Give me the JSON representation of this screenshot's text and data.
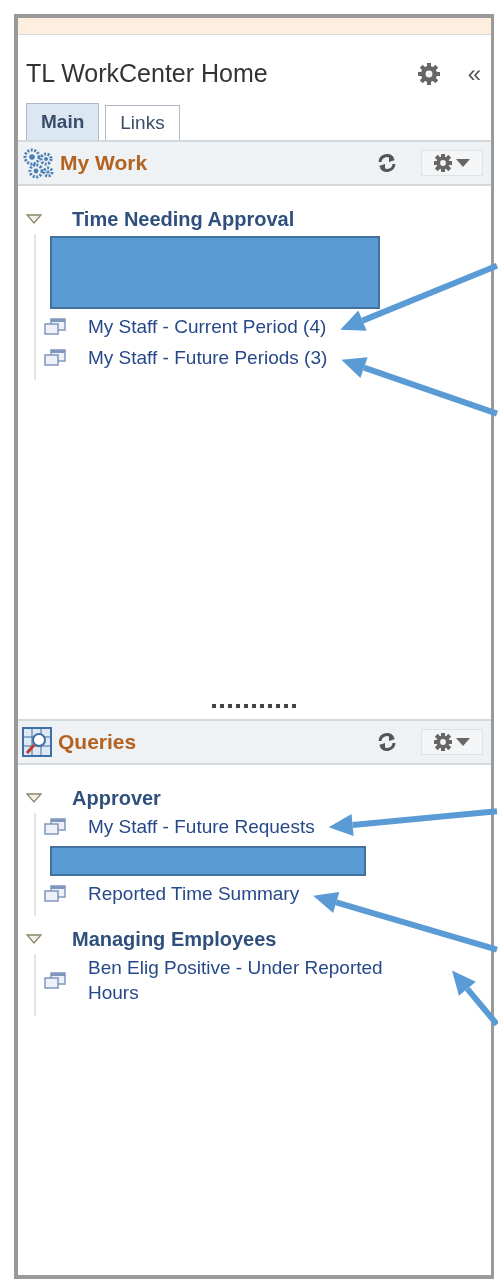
{
  "title": "TL WorkCenter Home",
  "collapse": "«",
  "tabs": [
    {
      "label": "Main",
      "selected": true
    },
    {
      "label": "Links",
      "selected": false
    }
  ],
  "pagelets": [
    {
      "title": "My Work",
      "groups": [
        {
          "label": "Time Needing Approval",
          "expanded": true,
          "items": [
            {
              "kind": "redacted"
            },
            {
              "kind": "link",
              "label": "My Staff - Current Period (4)",
              "arrow": true
            },
            {
              "kind": "link",
              "label": "My Staff - Future Periods (3)",
              "arrow": true
            }
          ]
        }
      ]
    },
    {
      "title": "Queries",
      "groups": [
        {
          "label": "Approver",
          "expanded": true,
          "items": [
            {
              "kind": "link",
              "label": "My Staff - Future Requests",
              "arrow": true
            },
            {
              "kind": "redacted"
            },
            {
              "kind": "link",
              "label": "Reported Time Summary",
              "arrow": true
            }
          ]
        },
        {
          "label": "Managing Employees",
          "expanded": true,
          "items": [
            {
              "kind": "link",
              "label": "Ben Elig Positive - Under Reported Hours",
              "arrow": true
            }
          ]
        }
      ]
    }
  ]
}
